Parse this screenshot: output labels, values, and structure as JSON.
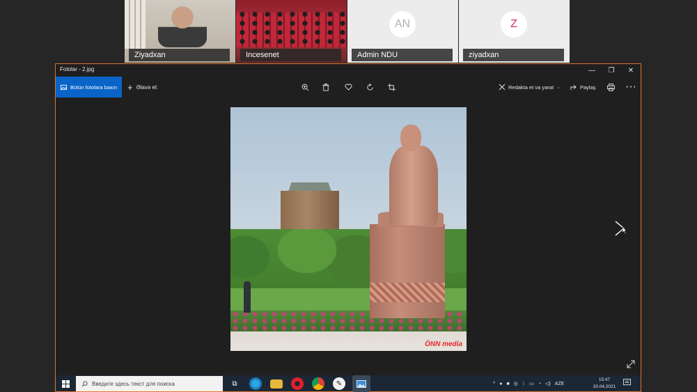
{
  "meeting": {
    "tiles": [
      {
        "name": "Ziyadxan",
        "kind": "video"
      },
      {
        "name": "Incesenet",
        "kind": "video"
      },
      {
        "name": "Admin NDU",
        "kind": "avatar",
        "initials": "AN",
        "initials_color": "#b0b0b0"
      },
      {
        "name": "ziyadxan",
        "kind": "avatar",
        "initials": "Z",
        "initials_color": "#cf2b6b"
      }
    ]
  },
  "photos_app": {
    "window_title": "Fotolar - 2.jpg",
    "window_controls": {
      "minimize": "—",
      "restore": "❐",
      "close": "✕"
    },
    "toolbar": {
      "all_photos_label": "Bütün fotolara baxın",
      "add_label": "Əlavə et",
      "edit_create_label": "Redakta et va yarat",
      "share_label": "Paylaş",
      "more_label": "···"
    },
    "image": {
      "watermark": "ÖNN media"
    },
    "accent_color": "#0a64c8",
    "window_border_color": "#e0762e"
  },
  "taskbar": {
    "search_placeholder": "Введите здесь текст для поиска",
    "language": "AZE",
    "time": "15:47",
    "date": "20.04.2021"
  }
}
